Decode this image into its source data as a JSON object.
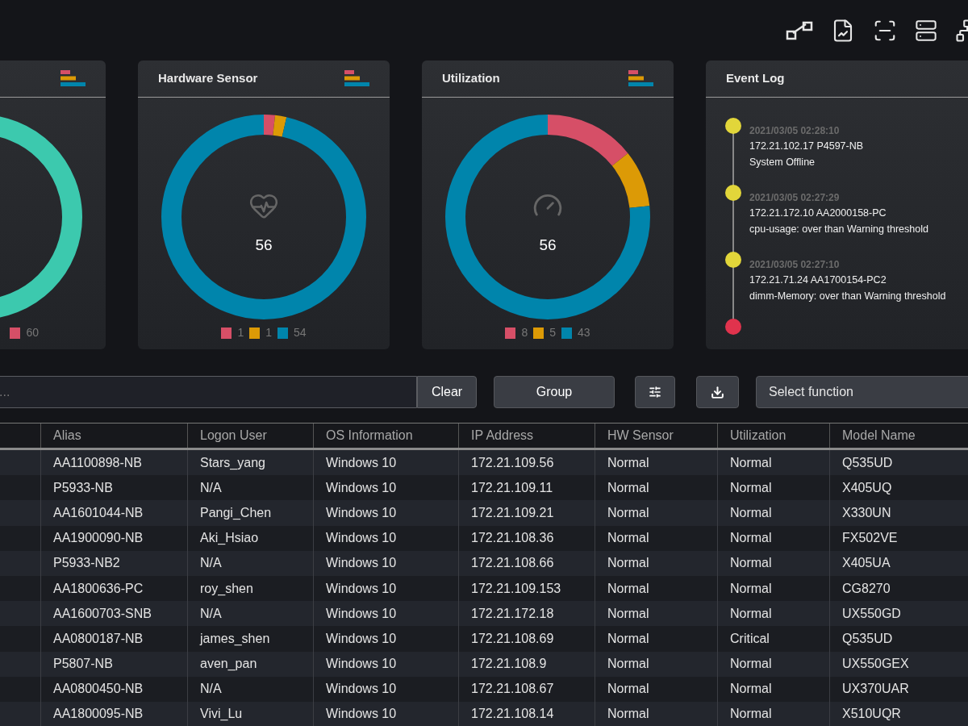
{
  "cards": [
    {
      "kind": "ring",
      "legend": [
        {
          "color": "#d64f67",
          "label": "60"
        }
      ]
    },
    {
      "kind": "donut",
      "title": "Hardware Sensor",
      "center": "56",
      "legend": [
        {
          "color": "#d64f67",
          "label": "1"
        },
        {
          "color": "#dc9a06",
          "label": "1"
        },
        {
          "color": "#0085ac",
          "label": "54"
        }
      ]
    },
    {
      "kind": "donut",
      "title": "Utilization",
      "center": "56",
      "legend": [
        {
          "color": "#d64f67",
          "label": "8"
        },
        {
          "color": "#dc9a06",
          "label": "5"
        },
        {
          "color": "#0085ac",
          "label": "43"
        }
      ]
    }
  ],
  "event_log": {
    "title": "Event Log",
    "events": [
      {
        "color": "#e2d63a",
        "time": "2021/03/05 02:28:10",
        "source": "172.21.102.17 P4597-NB",
        "message": "System Offline"
      },
      {
        "color": "#e2d63a",
        "time": "2021/03/05 02:27:29",
        "source": "172.21.172.10 AA2000158-PC",
        "message": "cpu-usage: over than Warning threshold"
      },
      {
        "color": "#e2d63a",
        "time": "2021/03/05 02:27:10",
        "source": "172.21.71.24 AA1700154-PC2",
        "message": "dimm-Memory: over than Warning threshold"
      },
      {
        "color": "#e0334d"
      }
    ]
  },
  "toolbar": {
    "search": {
      "placeholder": "..."
    },
    "clear": "Clear",
    "group": "Group",
    "select": {
      "placeholder": "Select function"
    }
  },
  "table": {
    "columns": [
      "",
      "Alias",
      "Logon User",
      "OS Information",
      "IP Address",
      "HW Sensor",
      "Utilization",
      "Model Name"
    ],
    "rows": [
      [
        "",
        "AA1100898-NB",
        "Stars_yang",
        "Windows 10",
        "172.21.109.56",
        "Normal",
        "Normal",
        "Q535UD"
      ],
      [
        "",
        "P5933-NB",
        "N/A",
        "Windows 10",
        "172.21.109.11",
        "Normal",
        "Normal",
        "X405UQ"
      ],
      [
        "",
        "AA1601044-NB",
        "Pangi_Chen",
        "Windows 10",
        "172.21.109.21",
        "Normal",
        "Normal",
        "X330UN"
      ],
      [
        "",
        "AA1900090-NB",
        "Aki_Hsiao",
        "Windows 10",
        "172.21.108.36",
        "Normal",
        "Normal",
        "FX502VE"
      ],
      [
        "",
        "P5933-NB2",
        "N/A",
        "Windows 10",
        "172.21.108.66",
        "Normal",
        "Normal",
        "X405UA"
      ],
      [
        "",
        "AA1800636-PC",
        "roy_shen",
        "Windows 10",
        "172.21.109.153",
        "Normal",
        "Normal",
        "CG8270"
      ],
      [
        "",
        "AA1600703-SNB",
        "N/A",
        "Windows 10",
        "172.21.172.18",
        "Normal",
        "Normal",
        "UX550GD"
      ],
      [
        "",
        "AA0800187-NB",
        "james_shen",
        "Windows 10",
        "172.21.108.69",
        "Normal",
        "Critical",
        "Q535UD"
      ],
      [
        "",
        "P5807-NB",
        "aven_pan",
        "Windows 10",
        "172.21.108.9",
        "Normal",
        "Normal",
        "UX550GEX"
      ],
      [
        "",
        "AA0800450-NB",
        "N/A",
        "Windows 10",
        "172.21.108.67",
        "Normal",
        "Normal",
        "UX370UAR"
      ],
      [
        "",
        "AA1800095-NB",
        "Vivi_Lu",
        "Windows 10",
        "172.21.108.14",
        "Normal",
        "Normal",
        "X510UQR"
      ]
    ]
  }
}
